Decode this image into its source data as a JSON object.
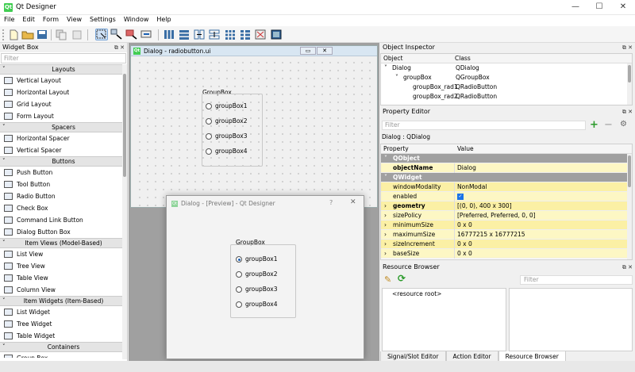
{
  "window": {
    "title": "Qt Designer",
    "app_icon": "qt-icon",
    "min": "—",
    "max": "☐",
    "close": "✕"
  },
  "menu": [
    "File",
    "Edit",
    "Form",
    "View",
    "Settings",
    "Window",
    "Help"
  ],
  "toolbar": {
    "icons": [
      "new-file-icon",
      "open-folder-icon",
      "save-icon",
      "copy-icon",
      "paste-icon",
      "edit-widgets-icon",
      "edit-signals-icon",
      "edit-buddies-icon",
      "edit-tab-order-icon",
      "layout-horizontal-icon",
      "layout-vertical-icon",
      "layout-h-splitter-icon",
      "layout-v-splitter-icon",
      "layout-grid-icon",
      "layout-form-icon",
      "break-layout-icon",
      "adjust-size-icon"
    ]
  },
  "widget_box": {
    "title": "Widget Box",
    "filter_placeholder": "Filter",
    "categories": [
      {
        "name": "Layouts",
        "items": [
          "Vertical Layout",
          "Horizontal Layout",
          "Grid Layout",
          "Form Layout"
        ]
      },
      {
        "name": "Spacers",
        "items": [
          "Horizontal Spacer",
          "Vertical Spacer"
        ]
      },
      {
        "name": "Buttons",
        "items": [
          "Push Button",
          "Tool Button",
          "Radio Button",
          "Check Box",
          "Command Link Button",
          "Dialog Button Box"
        ]
      },
      {
        "name": "Item Views (Model-Based)",
        "items": [
          "List View",
          "Tree View",
          "Table View",
          "Column View"
        ]
      },
      {
        "name": "Item Widgets (Item-Based)",
        "items": [
          "List Widget",
          "Tree Widget",
          "Table Widget"
        ]
      },
      {
        "name": "Containers",
        "items": [
          "Group Box"
        ]
      }
    ]
  },
  "form": {
    "title": "Dialog - radiobutton.ui",
    "groupbox_title": "GroupBox",
    "radios": [
      "groupBox1",
      "groupBox2",
      "groupBox3",
      "groupBox4"
    ]
  },
  "preview": {
    "title": "Dialog - [Preview] - Qt Designer",
    "help": "?",
    "close": "✕",
    "groupbox_title": "GroupBox",
    "radios": [
      "groupBox1",
      "groupBox2",
      "groupBox3",
      "groupBox4"
    ],
    "checked_index": 0
  },
  "object_inspector": {
    "title": "Object Inspector",
    "col_object": "Object",
    "col_class": "Class",
    "rows": [
      {
        "object": "Dialog",
        "class": "QDialog"
      },
      {
        "object": "groupBox",
        "class": "QGroupBox"
      },
      {
        "object": "groupBox_rad1",
        "class": "QRadioButton"
      },
      {
        "object": "groupBox_rad2",
        "class": "QRadioButton"
      }
    ]
  },
  "property_editor": {
    "title": "Property Editor",
    "filter_placeholder": "Filter",
    "context": "Dialog : QDialog",
    "col_property": "Property",
    "col_value": "Value",
    "rows": [
      {
        "type": "section",
        "property": "QObject",
        "value": ""
      },
      {
        "type": "row",
        "property": "objectName",
        "value": "Dialog",
        "bold": true
      },
      {
        "type": "section",
        "property": "QWidget",
        "value": ""
      },
      {
        "type": "row",
        "property": "windowModality",
        "value": "NonModal"
      },
      {
        "type": "row",
        "property": "enabled",
        "value": "✓"
      },
      {
        "type": "row",
        "property": "geometry",
        "value": "[(0, 0), 400 x 300]",
        "bold": true,
        "expand": true
      },
      {
        "type": "row",
        "property": "sizePolicy",
        "value": "[Preferred, Preferred, 0, 0]",
        "expand": true
      },
      {
        "type": "row",
        "property": "minimumSize",
        "value": "0 x 0",
        "expand": true
      },
      {
        "type": "row",
        "property": "maximumSize",
        "value": "16777215 x 16777215",
        "expand": true
      },
      {
        "type": "row",
        "property": "sizeIncrement",
        "value": "0 x 0",
        "expand": true
      },
      {
        "type": "row",
        "property": "baseSize",
        "value": "0 x 0",
        "expand": true
      }
    ]
  },
  "resource_browser": {
    "title": "Resource Browser",
    "filter_placeholder": "Filter",
    "root": "<resource root>"
  },
  "bottom_tabs": [
    "Signal/Slot Editor",
    "Action Editor",
    "Resource Browser"
  ]
}
